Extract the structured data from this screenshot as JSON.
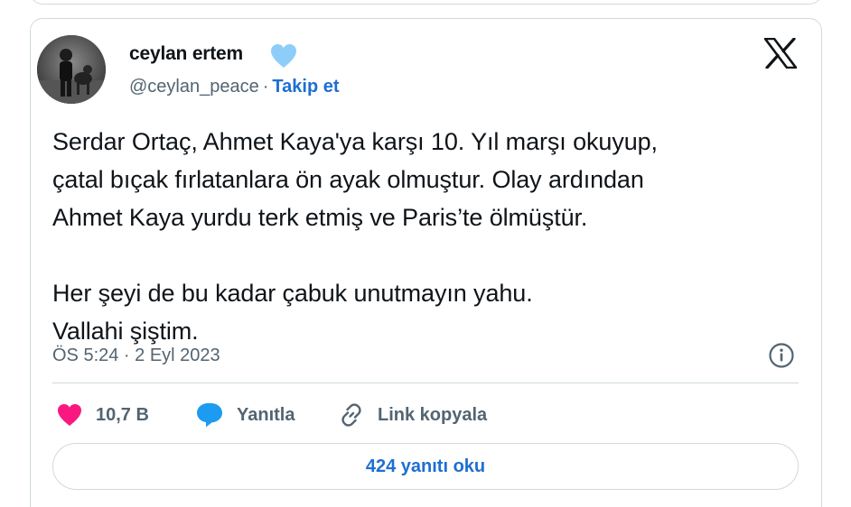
{
  "author": {
    "name": "ceylan ertem",
    "handle": "@ceylan_peace",
    "separator": "·",
    "follow_label": "Takip et",
    "avatar_icon": "profile-photo",
    "badge_icon": "light-blue-heart-icon"
  },
  "platform": {
    "logo_icon": "x-logo-icon"
  },
  "tweet": {
    "lines_paragraph_1": [
      "Serdar Ortaç, Ahmet Kaya'ya karşı 10. Yıl marşı okuyup,",
      "çatal bıçak fırlatanlara ön ayak olmuştur. Olay ardından",
      "Ahmet Kaya yurdu terk etmiş ve Paris’te ölmüştür."
    ],
    "lines_paragraph_2": [
      "Her şeyi de bu kadar çabuk unutmayın yahu.",
      "Vallahi şiştim."
    ],
    "timestamp": "ÖS 5:24 · 2 Eyl 2023",
    "info_icon": "info-icon"
  },
  "actions": {
    "like": {
      "icon": "heart-icon",
      "label": "10,7 B",
      "color": "#f91880"
    },
    "reply": {
      "icon": "speech-bubble-icon",
      "label": "Yanıtla",
      "color": "#1d9bf0"
    },
    "copy_link": {
      "icon": "link-icon",
      "label": "Link kopyala"
    }
  },
  "replies_button": {
    "label": "424 yanıtı oku"
  },
  "colors": {
    "accent": "#1d6fd1",
    "muted": "#536471",
    "border": "#cfd9de",
    "text": "#0f1419"
  }
}
